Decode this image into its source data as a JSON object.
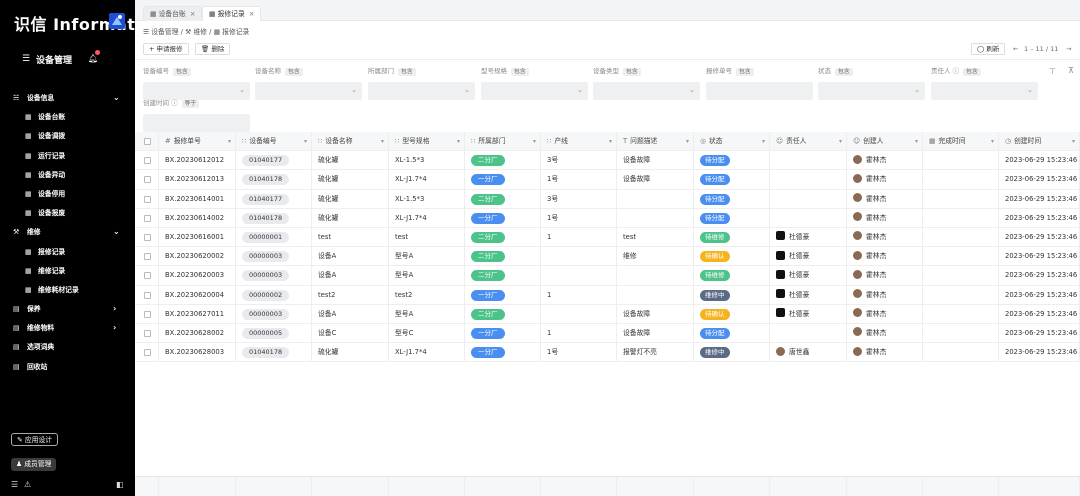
{
  "sidebar": {
    "brand": "识信 Informat",
    "module_title": "设备管理",
    "groups": [
      {
        "icon": "☵",
        "label": "设备信息",
        "chevron": "⌄"
      },
      {
        "icon": "▦",
        "label": "设备台账"
      },
      {
        "icon": "▦",
        "label": "设备调拨"
      },
      {
        "icon": "▦",
        "label": "运行记录"
      },
      {
        "icon": "▦",
        "label": "设备异动"
      },
      {
        "icon": "▦",
        "label": "设备停用"
      },
      {
        "icon": "▦",
        "label": "设备报废"
      },
      {
        "icon": "⚒",
        "label": "维修",
        "chevron": "⌄"
      },
      {
        "icon": "▦",
        "label": "报修记录"
      },
      {
        "icon": "▦",
        "label": "维修记录"
      },
      {
        "icon": "▦",
        "label": "维修耗材记录"
      },
      {
        "icon": "▤",
        "label": "保养",
        "chevron": "›"
      },
      {
        "icon": "▤",
        "label": "维修物料",
        "chevron": "›"
      },
      {
        "icon": "▤",
        "label": "选项词典"
      },
      {
        "icon": "▤",
        "label": "回收站"
      }
    ],
    "app_design": "应用设计",
    "member_mgmt": "成员管理"
  },
  "tabs": [
    {
      "label": "设备台账"
    },
    {
      "label": "报修记录"
    }
  ],
  "breadcrumb": {
    "part1": "设备管理",
    "part2": "维修",
    "part3": "报修记录"
  },
  "toolbar": {
    "add_label": "+ 申请报修",
    "delete_label": "删除",
    "refresh_label": "刷新",
    "pager_text": "1 – 11 / 11"
  },
  "filters": [
    {
      "label": "设备编号",
      "tag": "包含",
      "dropdown": true
    },
    {
      "label": "设备名称",
      "tag": "包含",
      "dropdown": true
    },
    {
      "label": "所属部门",
      "tag": "包含",
      "dropdown": true
    },
    {
      "label": "型号规格",
      "tag": "包含",
      "dropdown": true
    },
    {
      "label": "设备类型",
      "tag": "包含",
      "dropdown": true
    },
    {
      "label": "报修单号",
      "tag": "包含",
      "dropdown": false
    },
    {
      "label": "状态",
      "tag": "包含",
      "dropdown": true
    },
    {
      "label": "责任人",
      "tag": "包含",
      "dropdown": true,
      "info": true
    },
    {
      "label": "创建时间",
      "tag": "等于",
      "dropdown": false,
      "info": true
    }
  ],
  "columns": [
    {
      "icon": "#",
      "label": "报修单号"
    },
    {
      "icon": "∷",
      "label": "设备编号"
    },
    {
      "icon": "∷",
      "label": "设备名称"
    },
    {
      "icon": "∷",
      "label": "型号规格"
    },
    {
      "icon": "∷",
      "label": "所属部门"
    },
    {
      "icon": "∷",
      "label": "产线"
    },
    {
      "icon": "T",
      "label": "问题描述"
    },
    {
      "icon": "◎",
      "label": "状态"
    },
    {
      "icon": "☺",
      "label": "责任人"
    },
    {
      "icon": "☺",
      "label": "创建人"
    },
    {
      "icon": "▦",
      "label": "完成时间"
    },
    {
      "icon": "◷",
      "label": "创建时间"
    }
  ],
  "rows": [
    {
      "no": "BX.20230612012",
      "code": "01040177",
      "name": "硫化罐",
      "model": "XL-1.5*3",
      "dept": "二分厂",
      "line": "3号",
      "desc": "设备故障",
      "status": "待分配",
      "owner": "",
      "creator": "霍林杰",
      "finish": "",
      "created": "2023-06-29 15:23:46"
    },
    {
      "no": "BX.20230612013",
      "code": "01040178",
      "name": "硫化罐",
      "model": "XL-J1.7*4",
      "dept": "一分厂",
      "line": "1号",
      "desc": "设备故障",
      "status": "待分配",
      "owner": "",
      "creator": "霍林杰",
      "finish": "",
      "created": "2023-06-29 15:23:46"
    },
    {
      "no": "BX.20230614001",
      "code": "01040177",
      "name": "硫化罐",
      "model": "XL-1.5*3",
      "dept": "二分厂",
      "line": "3号",
      "desc": "",
      "status": "待分配",
      "owner": "",
      "creator": "霍林杰",
      "finish": "",
      "created": "2023-06-29 15:23:46"
    },
    {
      "no": "BX.20230614002",
      "code": "01040178",
      "name": "硫化罐",
      "model": "XL-J1.7*4",
      "dept": "一分厂",
      "line": "1号",
      "desc": "",
      "status": "待分配",
      "owner": "",
      "creator": "霍林杰",
      "finish": "",
      "created": "2023-06-29 15:23:46"
    },
    {
      "no": "BX.20230616001",
      "code": "00000001",
      "name": "test",
      "model": "test",
      "dept": "二分厂",
      "line": "1",
      "desc": "test",
      "status": "待维修",
      "owner": "杜德豪",
      "creator": "霍林杰",
      "finish": "",
      "created": "2023-06-29 15:23:46"
    },
    {
      "no": "BX.20230620002",
      "code": "00000003",
      "name": "设备A",
      "model": "型号A",
      "dept": "二分厂",
      "line": "",
      "desc": "维修",
      "status": "待确认",
      "owner": "杜德豪",
      "creator": "霍林杰",
      "finish": "",
      "created": "2023-06-29 15:23:46"
    },
    {
      "no": "BX.20230620003",
      "code": "00000003",
      "name": "设备A",
      "model": "型号A",
      "dept": "二分厂",
      "line": "",
      "desc": "",
      "status": "待维修",
      "owner": "杜德豪",
      "creator": "霍林杰",
      "finish": "",
      "created": "2023-06-29 15:23:46"
    },
    {
      "no": "BX.20230620004",
      "code": "00000002",
      "name": "test2",
      "model": "test2",
      "dept": "一分厂",
      "line": "1",
      "desc": "",
      "status": "维修中",
      "owner": "杜德豪",
      "creator": "霍林杰",
      "finish": "",
      "created": "2023-06-29 15:23:46"
    },
    {
      "no": "BX.20230627011",
      "code": "00000003",
      "name": "设备A",
      "model": "型号A",
      "dept": "二分厂",
      "line": "",
      "desc": "设备故障",
      "status": "待确认",
      "owner": "杜德豪",
      "creator": "霍林杰",
      "finish": "",
      "created": "2023-06-29 15:23:46"
    },
    {
      "no": "BX.20230628002",
      "code": "00000005",
      "name": "设备C",
      "model": "型号C",
      "dept": "一分厂",
      "line": "1",
      "desc": "设备故障",
      "status": "待分配",
      "owner": "",
      "creator": "霍林杰",
      "finish": "",
      "created": "2023-06-29 15:23:46"
    },
    {
      "no": "BX.20230628003",
      "code": "01040178",
      "name": "硫化罐",
      "model": "XL-J1.7*4",
      "dept": "一分厂",
      "line": "1号",
      "desc": "报警灯不亮",
      "status": "维修中",
      "owner": "唐世鑫",
      "creator": "霍林杰",
      "finish": "",
      "created": "2023-06-29 15:23:46"
    }
  ],
  "colors": {
    "dept": {
      "二分厂": "#4cc38a",
      "一分厂": "#4a8ff0"
    },
    "status": {
      "待分配": "#4a8ff0",
      "待维修": "#4cc38a",
      "待确认": "#f5b41f",
      "维修中": "#5b6b85"
    }
  }
}
